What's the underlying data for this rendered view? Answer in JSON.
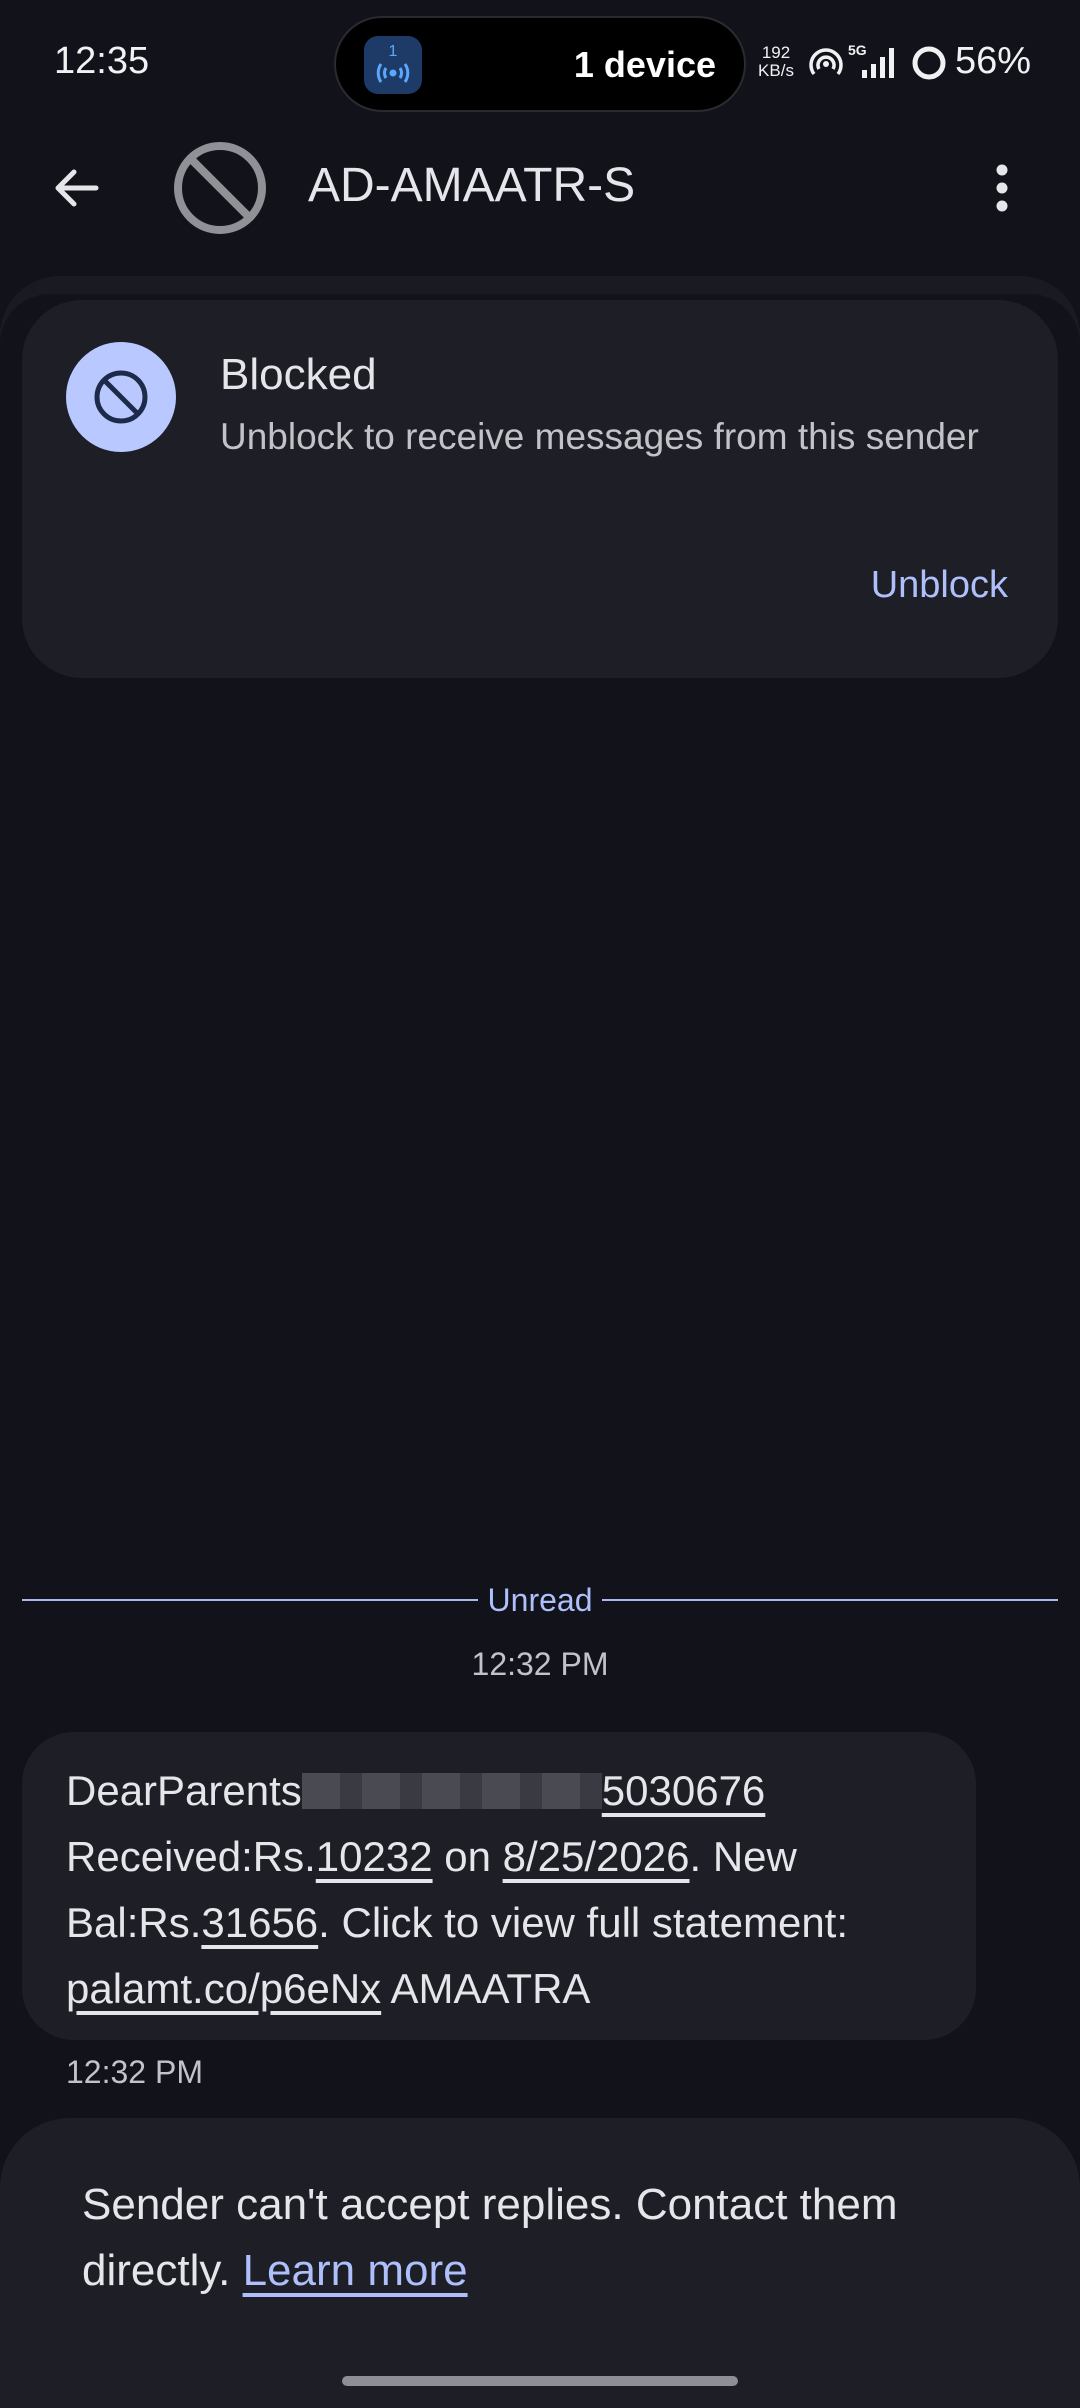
{
  "status_bar": {
    "time": "12:35",
    "island_badge_count": "1",
    "island_text": "1 device",
    "net_speed_value": "192",
    "net_speed_unit": "KB/s",
    "network_type": "5G",
    "battery": "56%"
  },
  "app_bar": {
    "title": "AD-AMAATR-S"
  },
  "blocked_card": {
    "title": "Blocked",
    "subtitle": "Unblock to receive messages from this sender",
    "unblock_label": "Unblock"
  },
  "unread_label": "Unread",
  "message": {
    "timestamp_header": "12:32 PM",
    "line1_prefix": "DearParents",
    "line1_link": "5030676",
    "text_received": "Received:Rs.",
    "amount": "10232",
    "text_on": " on ",
    "date": "8/25/2026",
    "text_new": ". New",
    "text_bal": "Bal:Rs.",
    "balance": "31656",
    "text_click": ". Click to view full statement:",
    "url": "palamt.co/p6eNx",
    "sender_tag": " AMAATRA",
    "timestamp_footer": "12:32 PM"
  },
  "reply_notice": {
    "text": "Sender can't accept replies. Contact them directly. ",
    "learn_more": "Learn more"
  },
  "colors": {
    "background": "#12131a",
    "surface": "#1e1f26",
    "accent": "#aebffb",
    "blocked_icon_bg": "#b9c8ff"
  }
}
